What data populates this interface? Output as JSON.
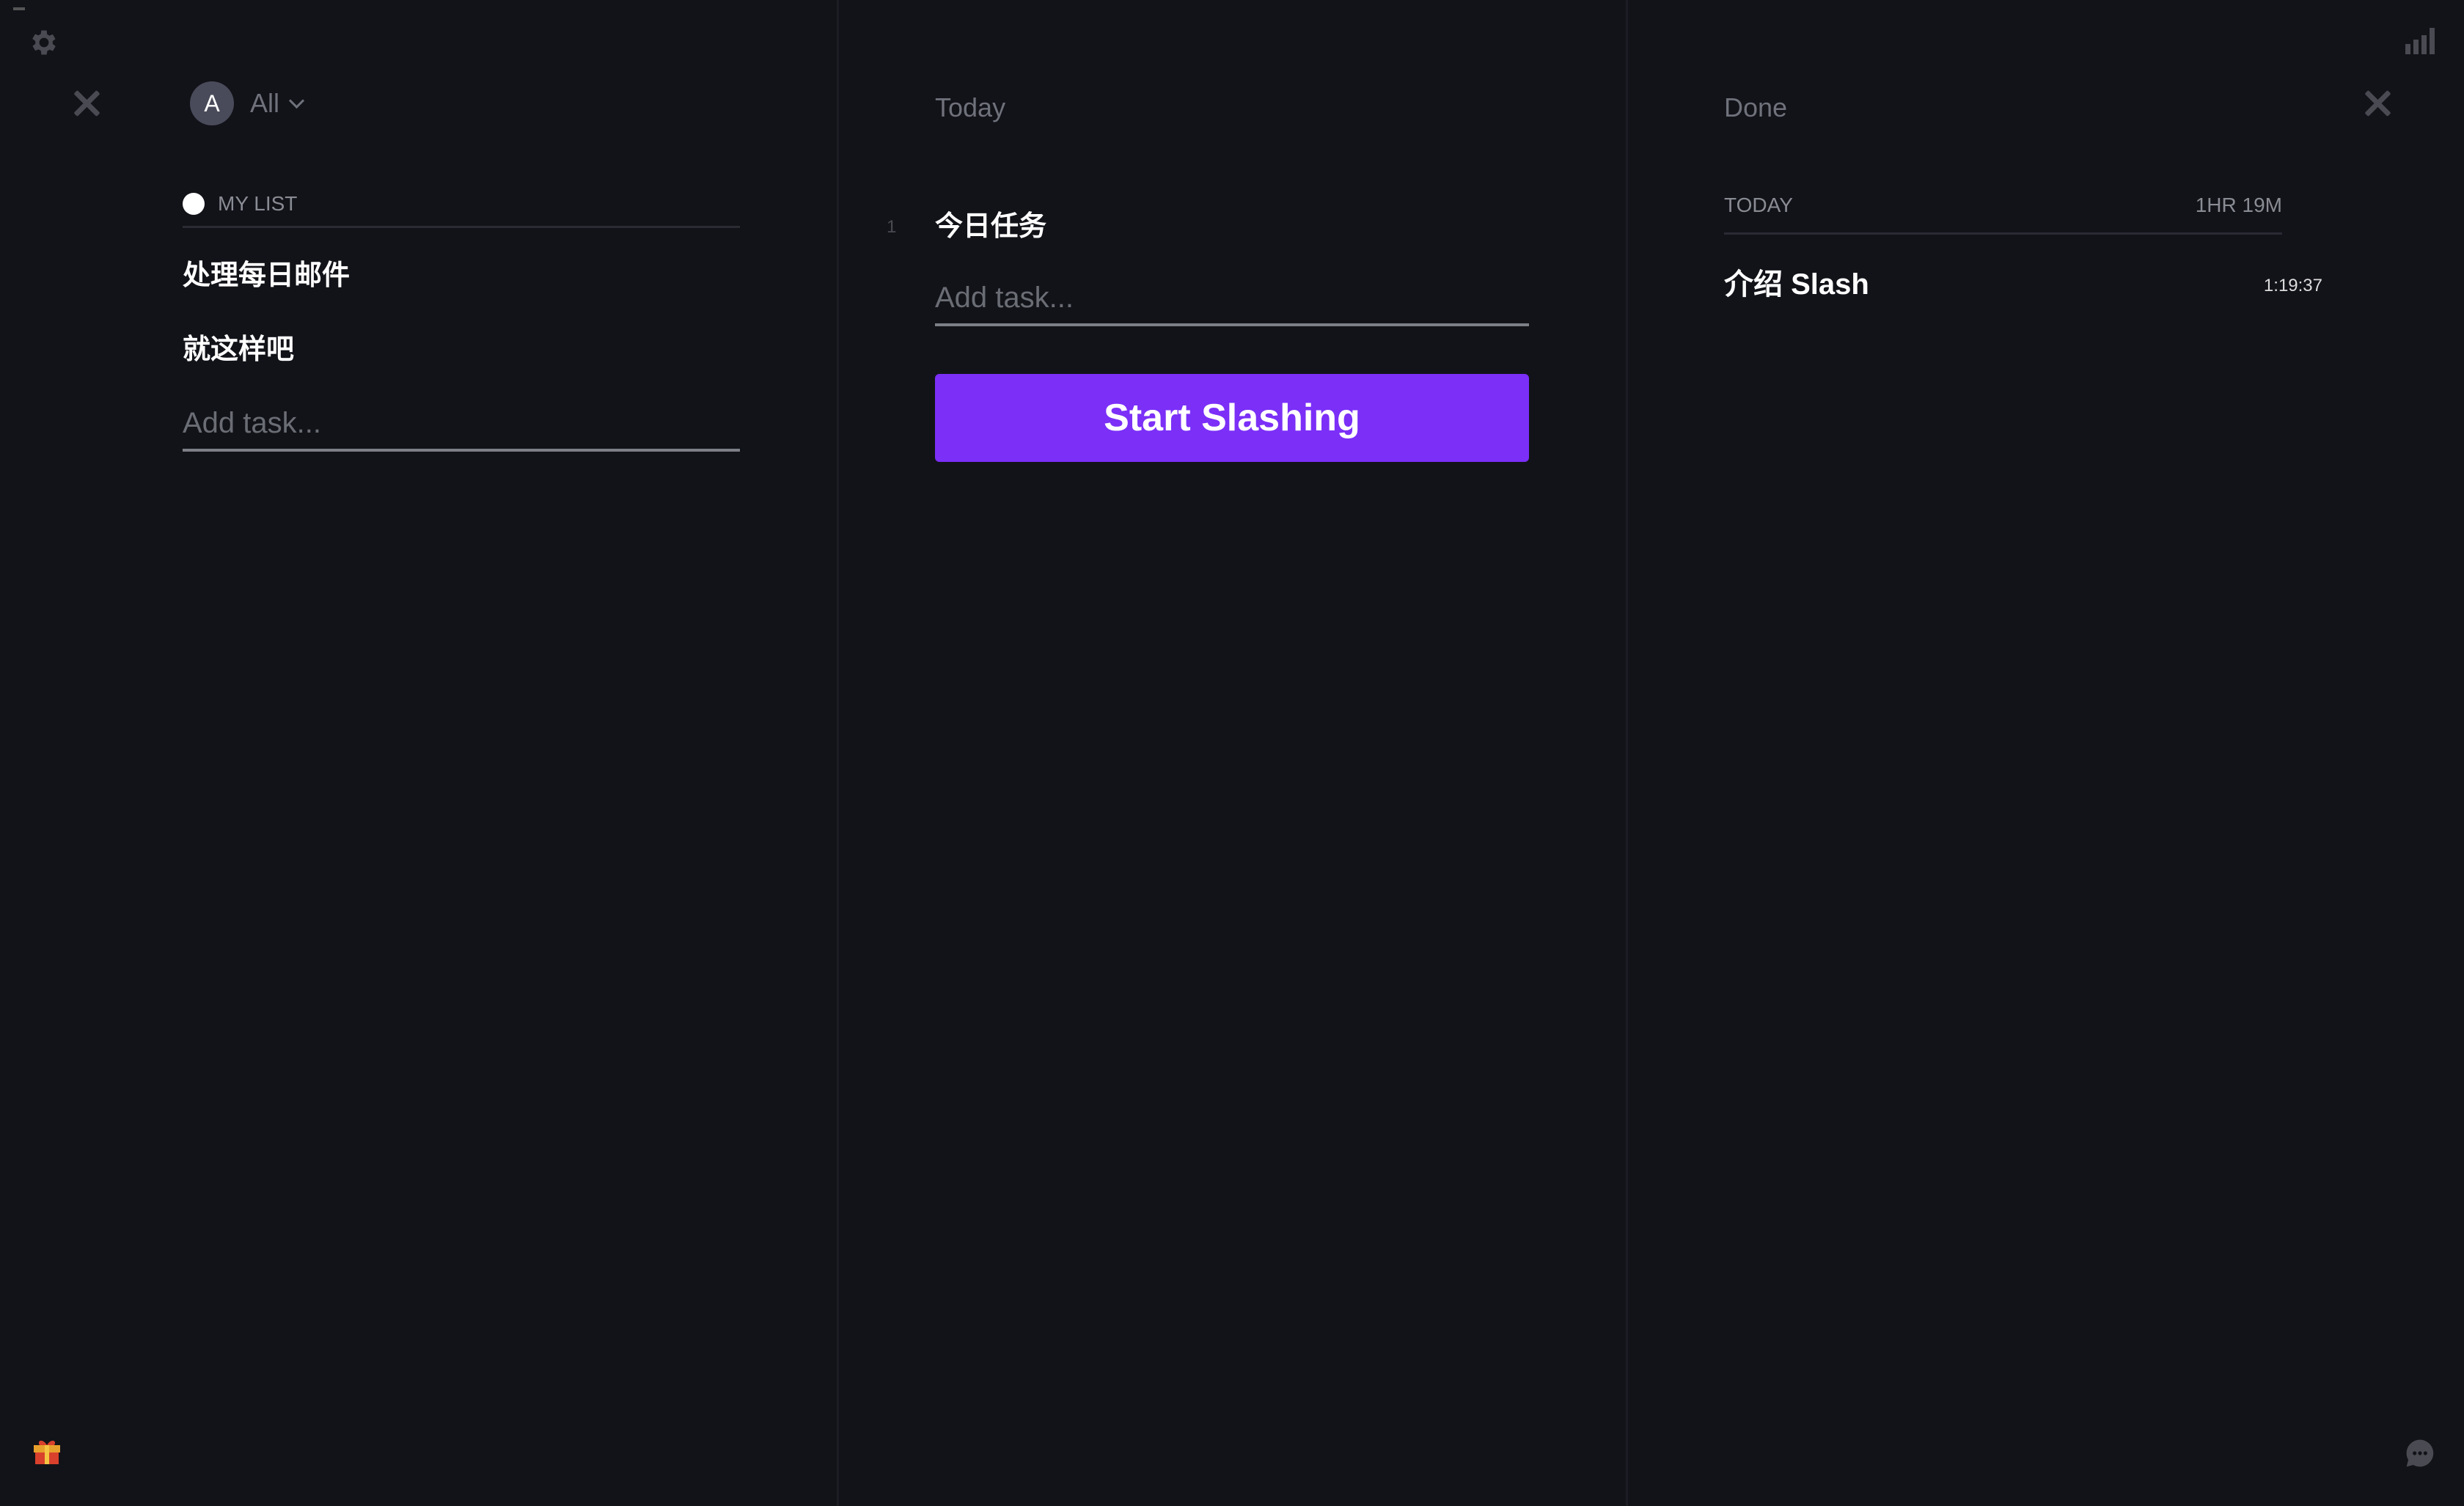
{
  "colors": {
    "background": "#121319",
    "accent": "#7b2ff7",
    "muted": "#6f717b"
  },
  "left": {
    "filter_avatar": "A",
    "filter_label": "All",
    "list_title": "MY LIST",
    "tasks": [
      {
        "label": "处理每日邮件"
      },
      {
        "label": "就这样吧"
      }
    ],
    "add_placeholder": "Add task..."
  },
  "today": {
    "title": "Today",
    "tasks": [
      {
        "index": "1",
        "label": "今日任务"
      }
    ],
    "add_placeholder": "Add task...",
    "start_button": "Start Slashing"
  },
  "done": {
    "title": "Done",
    "section_label": "TODAY",
    "section_total": "1HR 19M",
    "items": [
      {
        "label": "介绍 Slash",
        "duration": "1:19:37"
      }
    ]
  },
  "icons": {
    "settings": "gear-icon",
    "stats": "bar-chart-icon",
    "gift": "gift-icon",
    "chat": "chat-icon",
    "close": "close-icon"
  }
}
